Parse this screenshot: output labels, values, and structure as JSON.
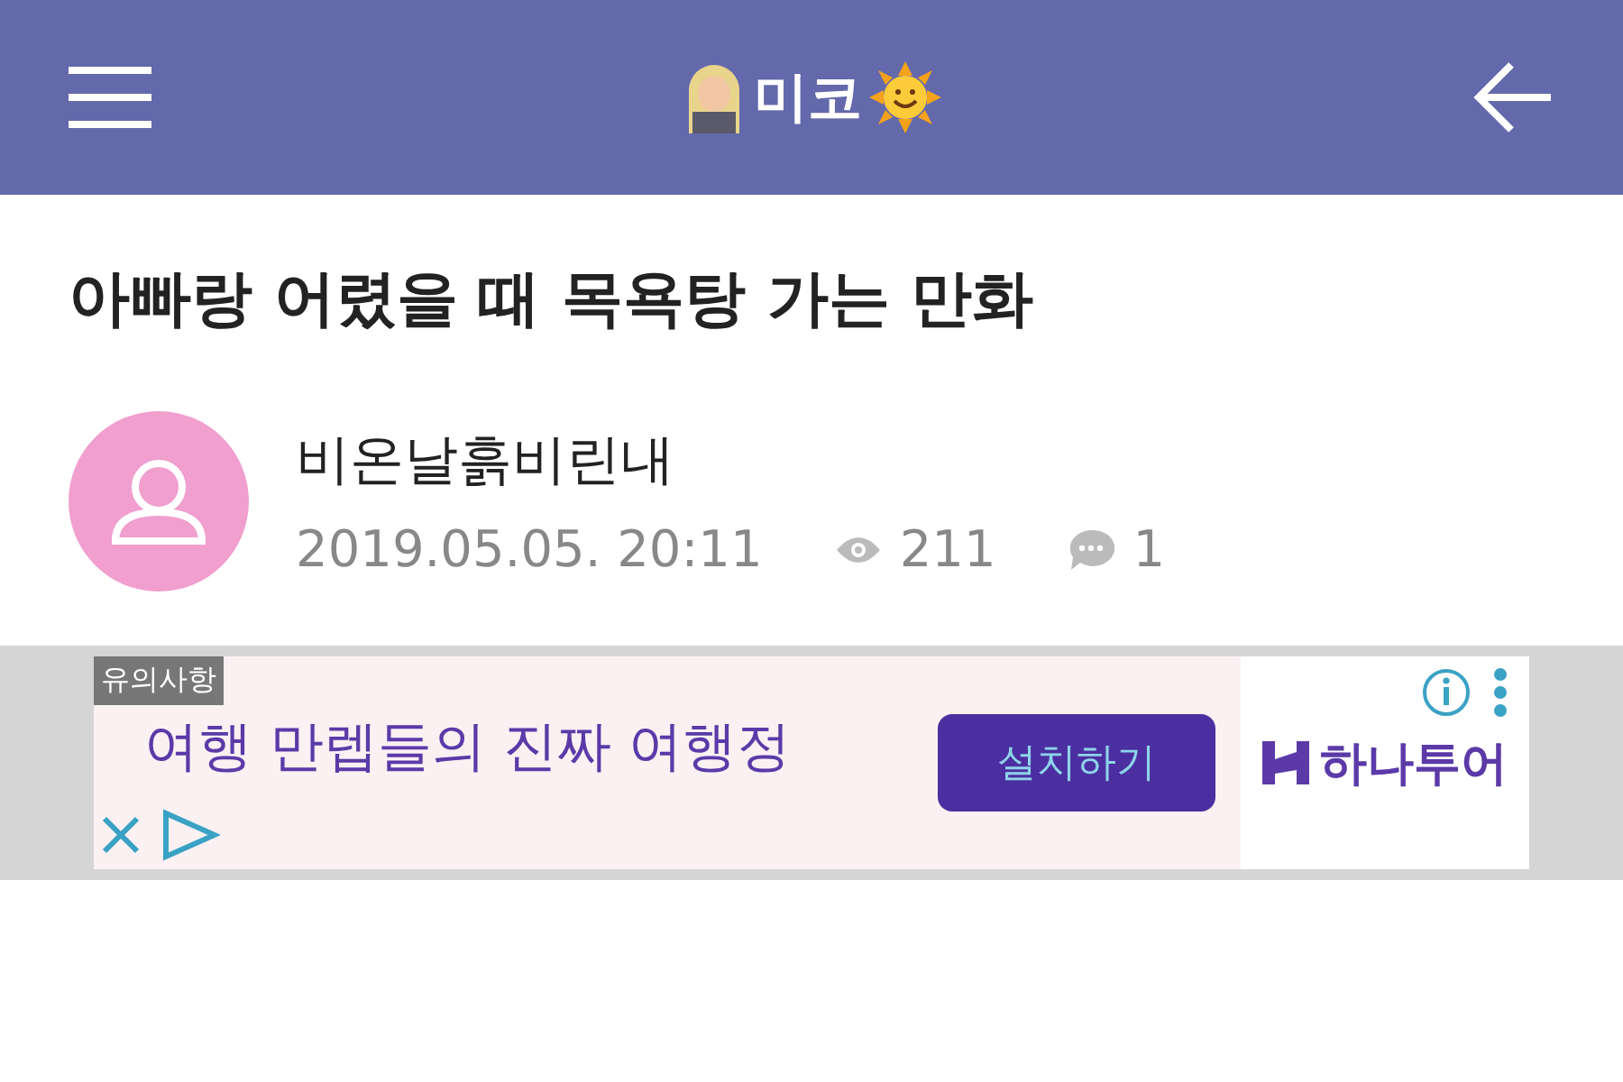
{
  "header": {
    "title": "미코"
  },
  "post": {
    "title": "아빠랑 어렸을 때 목욕탕 가는 만화",
    "author": "비온날흙비린내",
    "date": "2019.05.05. 20:11",
    "views": "211",
    "comments": "1"
  },
  "ad": {
    "notice": "유의사항",
    "headline": "여행 만렙들의 진짜 여행정",
    "button": "설치하기",
    "brand": "하나투어"
  }
}
